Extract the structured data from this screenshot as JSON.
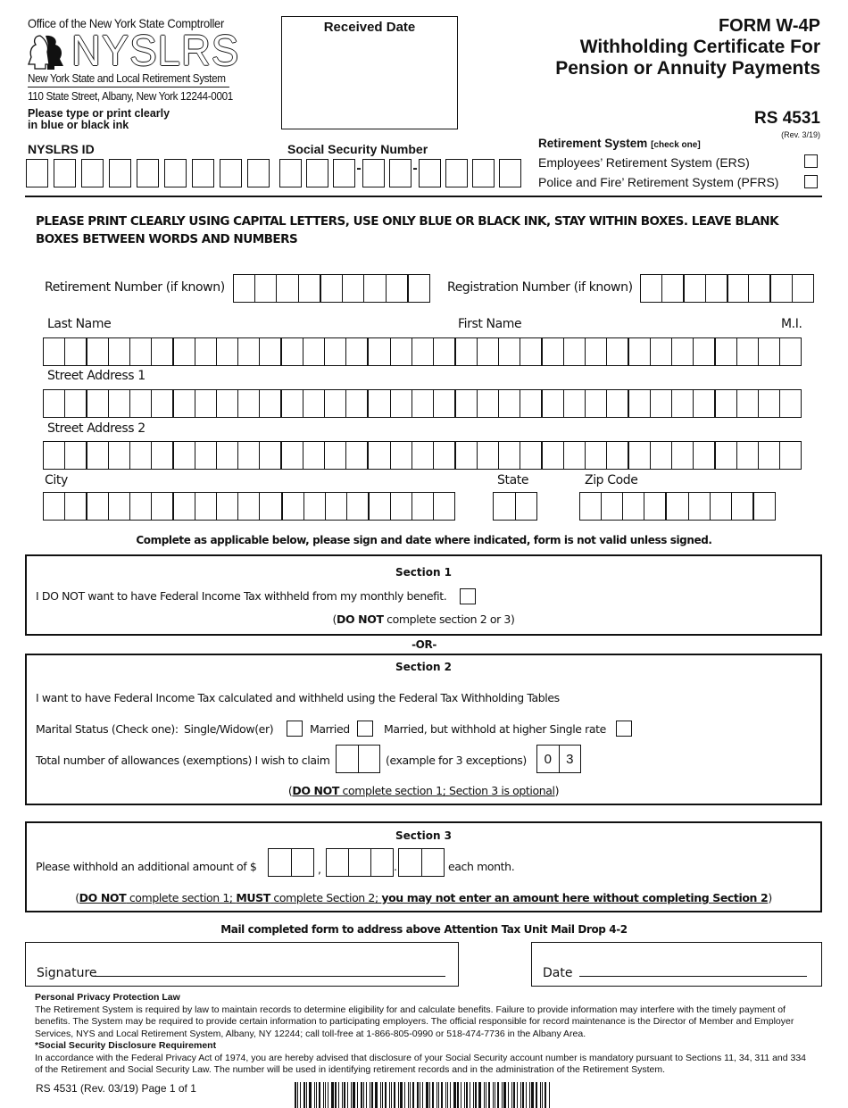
{
  "header": {
    "office": "Office of the New York State Comptroller",
    "logo_text": "NYSLRS",
    "system_name": "New York State and Local Retirement System",
    "address": "110 State Street, Albany, New York 12244-0001",
    "print_instruction_line1": "Please type or print clearly",
    "print_instruction_line2": "in blue or black ink",
    "received_date_label": "Received Date",
    "form_title_1": "FORM W-4P",
    "form_title_2": "Withholding Certificate For",
    "form_title_3": "Pension or Annuity Payments",
    "form_number": "RS 4531",
    "revision": "(Rev. 3/19)"
  },
  "retirement_system": {
    "label": "Retirement System",
    "hint": "[check one]",
    "options": [
      {
        "label": "Employees’ Retirement System (ERS)",
        "checked": false
      },
      {
        "label": "Police and Fire’ Retirement System (PFRS)",
        "checked": false
      }
    ]
  },
  "ids": {
    "nyslrs_id_label": "NYSLRS ID",
    "nyslrs_id_boxes": 9,
    "ssn_label": "Social Security Number",
    "ssn_groups": [
      3,
      2,
      4
    ],
    "ssn_separator": "-"
  },
  "instructions": "PLEASE PRINT CLEARLY USING CAPITAL LETTERS, USE ONLY BLUE OR BLACK INK, STAY WITHIN BOXES. LEAVE BLANK BOXES BETWEEN WORDS AND NUMBERS",
  "fields": {
    "retirement_number_label": "Retirement Number (if known)",
    "retirement_number_boxes": 9,
    "registration_number_label": "Registration Number (if known)",
    "registration_number_boxes": 8,
    "last_name_label": "Last Name",
    "first_name_label": "First Name",
    "mi_label": "M.I.",
    "street1_label": "Street Address 1",
    "street2_label": "Street Address 2",
    "city_label": "City",
    "state_label": "State",
    "zip_label": "Zip Code",
    "name_row_boxes": 35,
    "city_boxes": 19,
    "state_boxes": 2,
    "zip_boxes": 9
  },
  "complete_note": "Complete as applicable below, please sign and date where indicated, form is not valid unless signed.",
  "section1": {
    "title": "Section 1",
    "text": "I DO NOT want to have Federal Income Tax withheld from my monthly benefit.",
    "checked": false,
    "note_open": "(",
    "note_bold": "DO NOT",
    "note_rest": " complete section 2 or 3)"
  },
  "or_label": "-OR-",
  "section2": {
    "title": "Section 2",
    "intro": "I want to have Federal Income Tax calculated and withheld using the Federal Tax Withholding Tables",
    "marital_label": "Marital Status (Check one):",
    "marital_options": [
      {
        "label": "Single/Widow(er)",
        "checked": false
      },
      {
        "label": "Married",
        "checked": false
      },
      {
        "label": "Married, but withhold at higher Single rate",
        "checked": false
      }
    ],
    "allowances_label": "Total number of allowances (exemptions) I wish to claim",
    "example_label": "(example for 3 exceptions)",
    "example_digits": [
      "0",
      "3"
    ],
    "note_open": "(",
    "note_bold": "DO NOT",
    "note_rest": " complete section 1; Section 3 is optional",
    "note_close": ")"
  },
  "section3": {
    "title": "Section 3",
    "text": "Please withhold an additional amount of $",
    "comma": ",",
    "period": ".",
    "suffix": "each month.",
    "note_open": "(",
    "note_b1": "DO NOT",
    "note_t1": " complete section 1; ",
    "note_b2": "MUST",
    "note_t2": " complete Section 2; ",
    "note_b3": "you may not enter an amount here without completing Section 2",
    "note_close": ")"
  },
  "mail_note": "Mail completed form to address above Attention Tax Unit Mail Drop 4-2",
  "signature_label": "Signature",
  "date_label": "Date",
  "privacy": {
    "heading1": "Personal Privacy Protection Law",
    "body1": "The Retirement System is required by law to maintain records to determine eligibility for and calculate benefits. Failure to provide information may interfere with the timely payment of benefits. The System may be required to provide certain information to participating employers. The official responsible for record maintenance is the Director of Member and Employer Services, NYS and Local Retirement System, Albany, NY 12244; call toll-free at 1-866-805-0990 or 518-474-7736 in the Albany Area.",
    "heading2": "*Social Security Disclosure Requirement",
    "body2": "In accordance with the Federal Privacy Act of 1974, you are hereby advised that disclosure of your Social Security account number is mandatory pursuant to Sections 11, 34, 311 and 334 of the Retirement and Social Security Law.  The number will be used in identifying retirement records and in the administration of the Retirement System."
  },
  "footer": "RS 4531 (Rev. 03/19) Page 1 of 1"
}
